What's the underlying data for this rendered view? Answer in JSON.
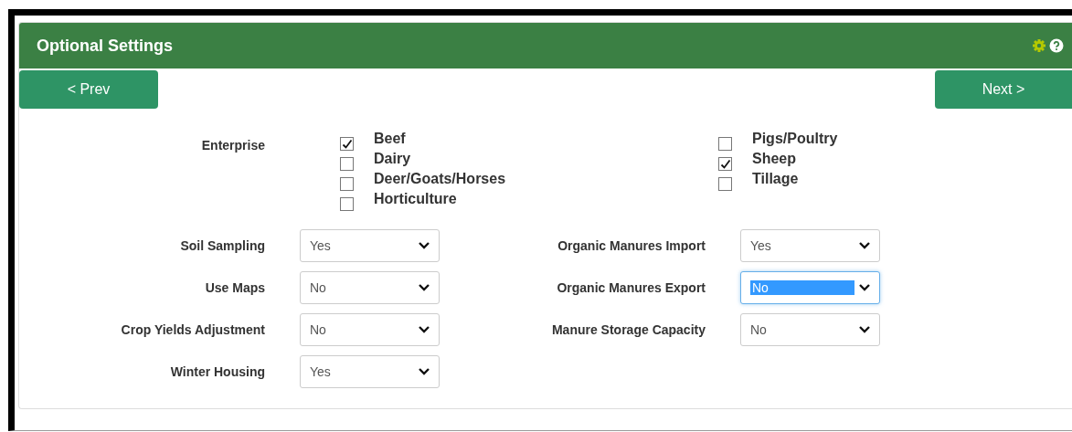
{
  "panel": {
    "title": "Optional Settings"
  },
  "nav": {
    "prev": "< Prev",
    "next": "Next >"
  },
  "enterprise": {
    "label": "Enterprise",
    "columns": [
      [
        {
          "label": "Beef",
          "checked": true
        },
        {
          "label": "Dairy",
          "checked": false
        },
        {
          "label": "Deer/Goats/Horses",
          "checked": false
        },
        {
          "label": "Horticulture",
          "checked": false
        }
      ],
      [
        {
          "label": "Pigs/Poultry",
          "checked": false
        },
        {
          "label": "Sheep",
          "checked": true
        },
        {
          "label": "Tillage",
          "checked": false
        }
      ]
    ]
  },
  "settings": [
    [
      {
        "label": "Soil Sampling",
        "value": "Yes",
        "focused": false
      },
      {
        "label": "Organic Manures Import",
        "value": "Yes",
        "focused": false
      }
    ],
    [
      {
        "label": "Use Maps",
        "value": "No",
        "focused": false
      },
      {
        "label": "Organic Manures Export",
        "value": "No",
        "focused": true
      }
    ],
    [
      {
        "label": "Crop Yields Adjustment",
        "value": "No",
        "focused": false
      },
      {
        "label": "Manure Storage Capacity",
        "value": "No",
        "focused": false
      }
    ],
    [
      {
        "label": "Winter Housing",
        "value": "Yes",
        "focused": false
      }
    ]
  ]
}
